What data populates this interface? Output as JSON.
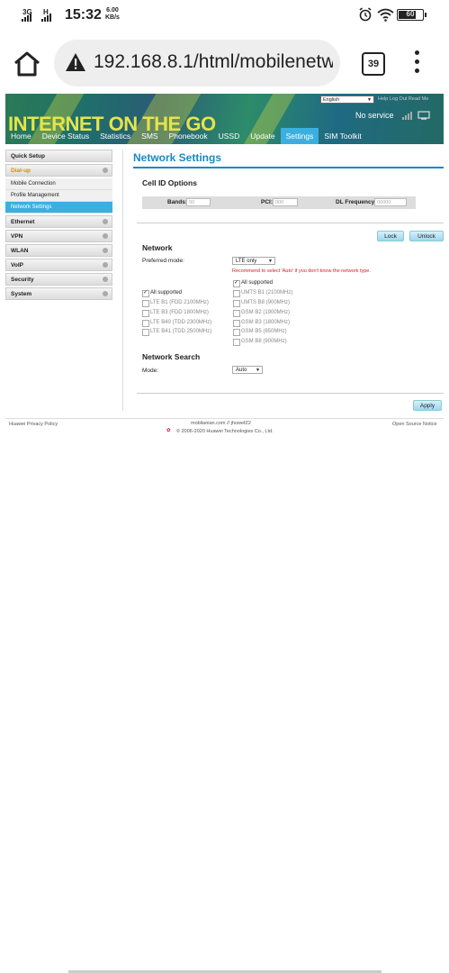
{
  "status_bar": {
    "signal1": "3G",
    "signal2": "H",
    "time": "15:32",
    "speed_value": "6.00",
    "speed_unit": "KB/s",
    "battery": "60"
  },
  "browser": {
    "url": "192.168.8.1/html/mobilenetw",
    "tab_count": "39"
  },
  "router": {
    "language": "English",
    "top_links": "Help  Log Out  Read Me",
    "banner_title": "INTERNET ON THE GO",
    "connection_status": "No service",
    "nav": [
      "Home",
      "Device Status",
      "Statistics",
      "SMS",
      "Phonebook",
      "USSD",
      "Update",
      "Settings",
      "SIM Toolkit"
    ],
    "sidebar": {
      "quick_setup": "Quick Setup",
      "dialup": "Dial-up",
      "dialup_sub": [
        "Mobile Connection",
        "Profile Management",
        "Network Settings"
      ],
      "items": [
        "Ethernet",
        "VPN",
        "WLAN",
        "VoIP",
        "Security",
        "System"
      ]
    },
    "page_title": "Network Settings",
    "cell_id": {
      "title": "Cell ID Options",
      "bands_label": "Bands:",
      "bands_value": "00",
      "pci_label": "PCI:",
      "pci_value": "000",
      "dl_label": "DL Frequency:",
      "dl_value": "00000"
    },
    "lock_label": "Lock",
    "unlock_label": "Unlock",
    "network": {
      "title": "Network",
      "preferred_mode_label": "Preferred mode:",
      "preferred_mode_value": "LTE only",
      "recommend": "Recommend to select 'Auto' if you don't know the network type.",
      "left_all": "All supported",
      "left_options": [
        "LTE B1 (FDD 2100MHz)",
        "LTE B3 (FDD 1800MHz)",
        "LTE B40 (TDD 2300MHz)",
        "LTE B41 (TDD 2500MHz)"
      ],
      "right_all": "All supported",
      "right_options": [
        "UMTS B1 (2100MHz)",
        "UMTS B8 (900MHz)",
        "GSM B2 (1900MHz)",
        "GSM B3 (1800MHz)",
        "GSM B5 (850MHz)",
        "GSM B8 (900MHz)"
      ]
    },
    "search": {
      "title": "Network Search",
      "mode_label": "Mode:",
      "mode_value": "Auto"
    },
    "apply_label": "Apply",
    "footer": {
      "privacy": "Huawei Privacy Policy",
      "center_line1": "mobilanian.com // jhowefZ2",
      "copyright": "© 2006-2020 Huawei Technologies Co., Ltd.",
      "open_source": "Open Source Notice"
    }
  }
}
